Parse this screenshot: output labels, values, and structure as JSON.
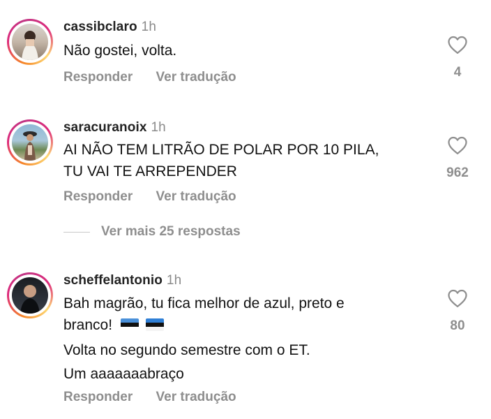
{
  "comments": [
    {
      "username": "cassibclaro",
      "time": "1h",
      "lines": [
        "Não gostei, volta."
      ],
      "reply_label": "Responder",
      "translate_label": "Ver tradução",
      "likes": "4"
    },
    {
      "username": "saracuranoix",
      "time": "1h",
      "lines": [
        "AI NÃO TEM LITRÃO DE POLAR POR 10 PILA,",
        "TU VAI TE ARREPENDER"
      ],
      "reply_label": "Responder",
      "translate_label": "Ver tradução",
      "likes": "962"
    },
    {
      "username": "scheffelantonio",
      "time": "1h",
      "lines": [
        "Bah magrão, tu fica melhor de azul, preto e",
        "branco!",
        "Volta no segundo semestre com o ET.",
        "Um aaaaaaabraço"
      ],
      "reply_label": "Responder",
      "translate_label": "Ver tradução",
      "likes": "80"
    }
  ],
  "view_more_replies": "Ver mais 25 respostas",
  "flag_icons": [
    "gremio-flag-icon",
    "estonia-flag-icon"
  ],
  "colors": {
    "meta_gray": "#8e8e8e",
    "flag_blue": "#4a90d9",
    "flag_black": "#111111",
    "flag_white": "#ffffff"
  }
}
